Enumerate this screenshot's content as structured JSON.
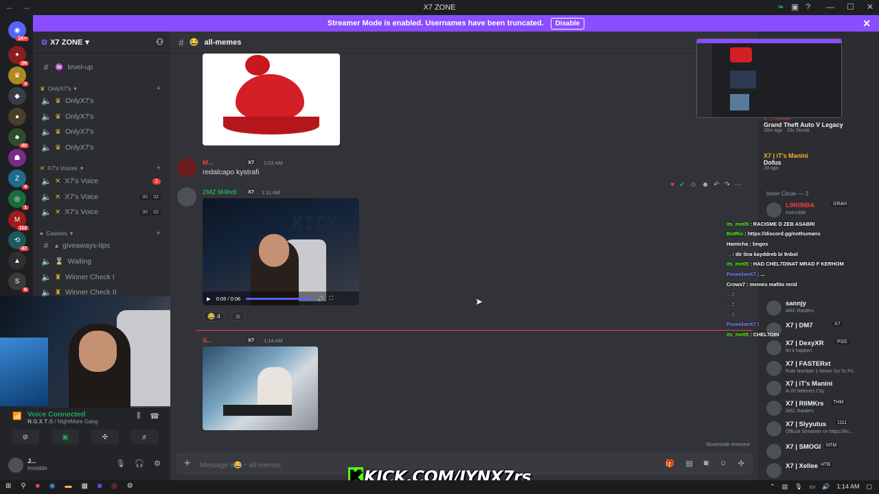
{
  "window": {
    "title": "X7 ZONE"
  },
  "banner": {
    "text": "Streamer Mode is enabled. Usernames have been truncated.",
    "button": "Disable"
  },
  "guilds": {
    "badges": [
      "1K+",
      "26",
      "3",
      "40",
      "4",
      "1",
      "112",
      "47",
      "6"
    ]
  },
  "server": {
    "name": "X7 ZONE"
  },
  "channels": {
    "top": {
      "name": "level-up"
    },
    "cat1": {
      "name": "OnlyX7's",
      "items": [
        "OnlyX7's",
        "OnlyX7's",
        "OnlyX7's",
        "OnlyX7's"
      ]
    },
    "cat2": {
      "name": "X7's Voices",
      "items": [
        "X7's Voice",
        "X7's Voice",
        "X7's Voice"
      ],
      "badge": "1",
      "nums1": [
        "00",
        "02"
      ],
      "nums2": [
        "00",
        "02"
      ]
    },
    "cat3": {
      "name": "Casinos",
      "items": [
        "giveaways-tips",
        "Waiting",
        "Winner Check I",
        "Winner Check II"
      ]
    }
  },
  "voice": {
    "title": "Voice Connected",
    "subtitle": "𝐍.𝐆.𝐗.𝐓.𝐒 / NightMare Gang"
  },
  "user": {
    "name": "J...",
    "status": "Invisible"
  },
  "chat": {
    "channel": "all-memes",
    "msg1": {
      "author": "M...",
      "tag": "X7",
      "time": "1:03 AM",
      "text": "redalcapo kystrafi"
    },
    "msg2": {
      "author": "ZMZ M4hdi",
      "tag": "X7",
      "time": "1:11 AM",
      "video_time": "0:05 / 0:06",
      "reaction_count": "4"
    },
    "msg3": {
      "author": "S...",
      "tag": "X7",
      "time": "1:14 AM"
    },
    "slowmode": "Slowmode Immune",
    "placeholder": "Message #😂・all-memes"
  },
  "members": {
    "activities": [
      {
        "user": "X7 | JWESI4",
        "title": "Grand Theft Auto V Legacy",
        "sub": "18m ago · 19x Streak"
      },
      {
        "user": "X7 | iT's Manini",
        "title": "Dofus",
        "sub": "2d ago"
      }
    ],
    "group": "Inner Circle — 2",
    "list": [
      {
        "name": "L9RI9IBA",
        "tag": "GRAH",
        "act": "Invincible"
      },
      {
        "name": "sannjy",
        "tag": "",
        "act": "ARC Raiders"
      },
      {
        "name": "X7 | DM7",
        "tag": "X7",
        "act": ""
      },
      {
        "name": "X7 | DexyXR",
        "tag": "PSG",
        "act": "let it happen"
      },
      {
        "name": "X7 | FASTERxt",
        "tag": "",
        "act": "Rule Number 1 Never Go To Pri..."
      },
      {
        "name": "X7 | iT's Manini",
        "tag": "",
        "act": "A-20 Nekmes City"
      },
      {
        "name": "X7 | RllMKrs",
        "tag": "THM",
        "act": "ARC Raiders"
      },
      {
        "name": "X7 | Slyyutus",
        "tag": "1111",
        "act": "Official Streamer on https://kic..."
      },
      {
        "name": "X7 | SMOGI",
        "tag": "NTM",
        "act": ""
      },
      {
        "name": "X7 | Xellee",
        "tag": "HTB",
        "act": ""
      }
    ]
  },
  "overlay_chat": [
    {
      "user": "its_me05",
      "msg": "RACISME D ZEB ASABRI",
      "color": "#53fc18"
    },
    {
      "user": "BotRix",
      "msg": "https://discord.gg/nothumans",
      "color": "#53fc18"
    },
    {
      "user": "Hamicha",
      "msg": "bngos",
      "color": "#ffffff"
    },
    {
      "user": "...",
      "msg": "dir lina kayddreb bi 9nbol",
      "color": "#e84855"
    },
    {
      "user": "its_me05",
      "msg": "HAD CHEL7DINAT MRAD F KERHOM",
      "color": "#53fc18"
    },
    {
      "user": "PoseidonX7",
      "msg": "...",
      "color": "#7b8cff"
    },
    {
      "user": "Crowx7",
      "msg": "memes mafito mrid",
      "color": "#ffffff"
    },
    {
      "user": "...",
      "msg": "",
      "color": "#e84855"
    },
    {
      "user": "...",
      "msg": "",
      "color": "#e84855"
    },
    {
      "user": "...",
      "msg": "",
      "color": "#e84855"
    },
    {
      "user": "PoseidonX7",
      "msg": "",
      "color": "#7b8cff"
    },
    {
      "user": "its_me05",
      "msg": "CHEL7DIN",
      "color": "#53fc18"
    }
  ],
  "kick": {
    "k": "K",
    "text": "KICK.COM/JYNX7rs"
  },
  "taskbar": {
    "time": "1:14 AM"
  },
  "colors": {
    "accent": "#5865f2",
    "banner": "#8a4dff",
    "green": "#23a55a",
    "kick": "#53fc18",
    "red": "#f23f43"
  }
}
